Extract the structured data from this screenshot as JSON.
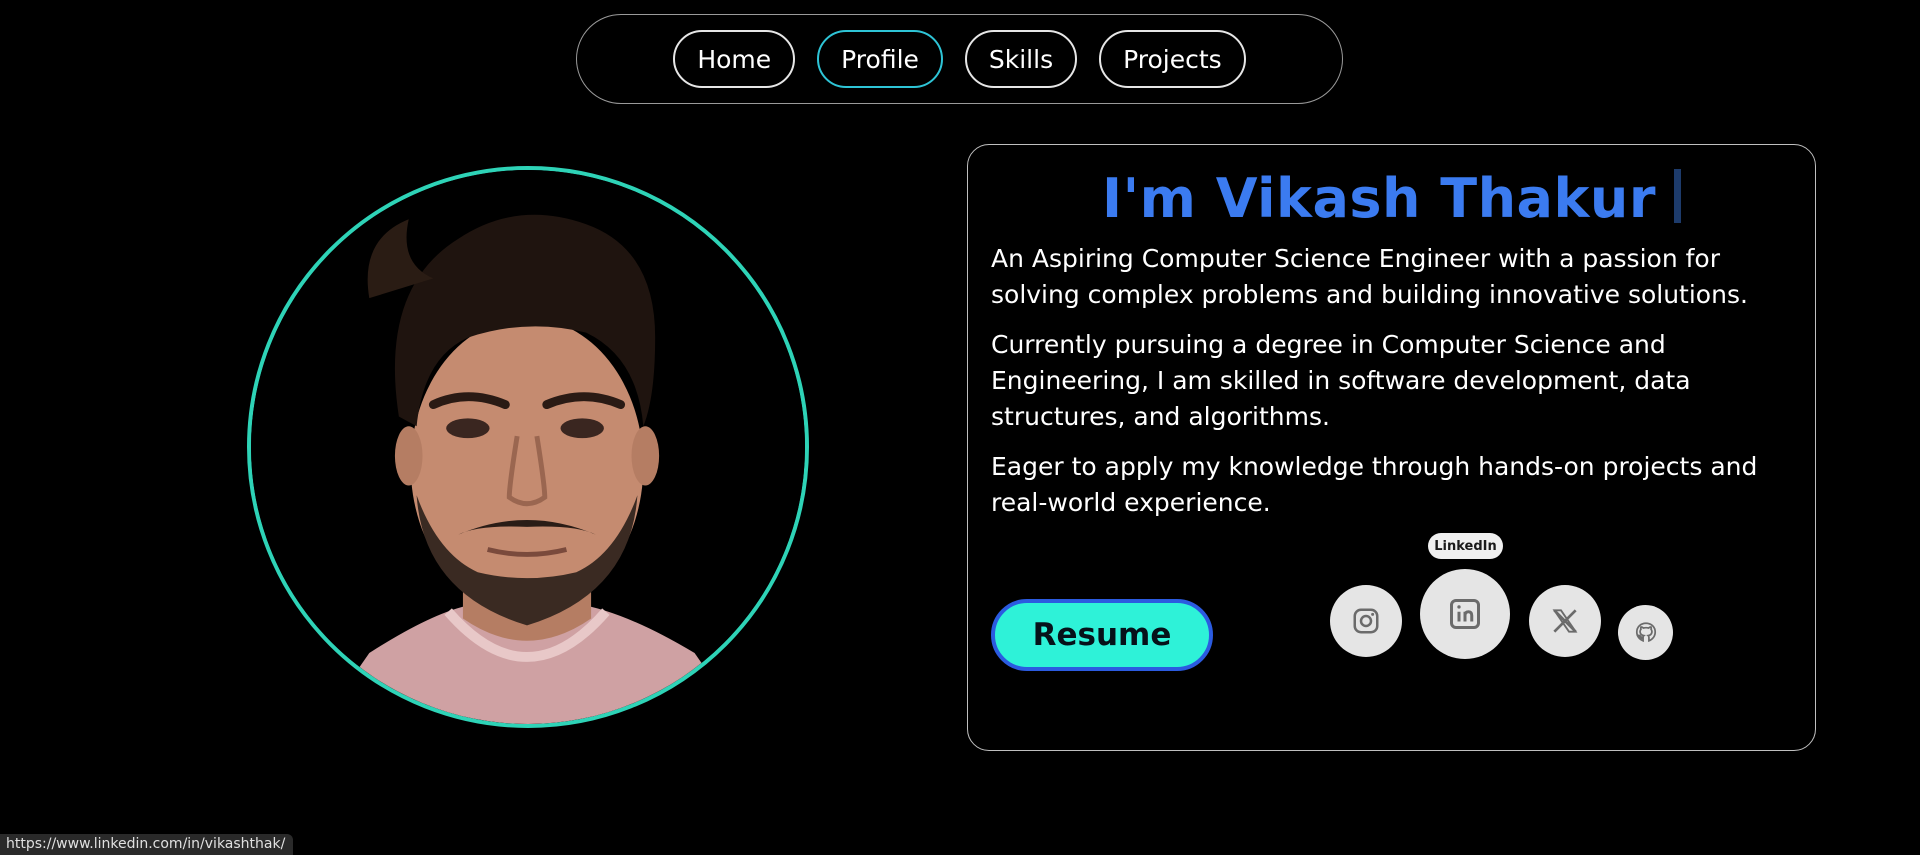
{
  "nav": {
    "items": [
      {
        "label": "Home"
      },
      {
        "label": "Profile"
      },
      {
        "label": "Skills"
      },
      {
        "label": "Projects"
      }
    ],
    "active": "Profile"
  },
  "profile": {
    "headline": "I'm Vikash Thakur",
    "bio": [
      "An Aspiring Computer Science Engineer with a passion for solving complex problems and building innovative solutions.",
      "Currently pursuing a degree in Computer Science and Engineering, I am skilled in software development, data structures, and algorithms.",
      "Eager to apply my knowledge through hands-on projects and real-world experience."
    ],
    "resume_label": "Resume"
  },
  "social": {
    "tooltip": "LinkedIn",
    "icons": [
      "instagram-icon",
      "linkedin-icon",
      "x-icon",
      "github-icon"
    ]
  },
  "status_bar": {
    "url": "https://www.linkedin.com/in/vikashthak/"
  },
  "colors": {
    "accent_blue": "#3b7bf0",
    "accent_teal": "#2ed3b7",
    "resume_fill": "#2ef2d8",
    "resume_border": "#2b5be0",
    "background": "#000000"
  }
}
